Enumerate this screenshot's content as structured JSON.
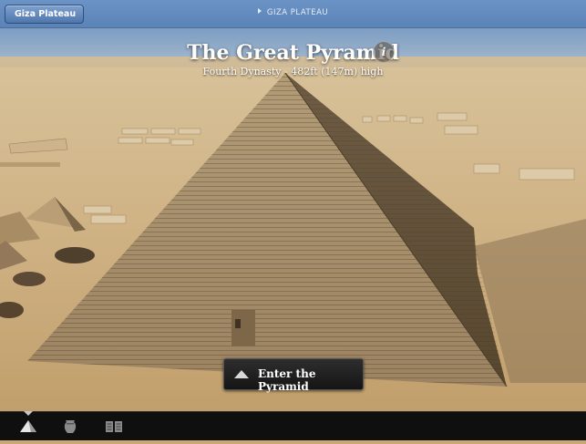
{
  "nav": {
    "back_label": "Giza Plateau",
    "breadcrumb": "GIZA PLATEAU"
  },
  "hero": {
    "title": "The Great Pyramid",
    "subtitle": "Fourth Dynasty - 482ft (147m) high",
    "info_icon": "info-icon"
  },
  "action": {
    "enter_label": "Enter the Pyramid",
    "icon": "pyramid-icon"
  },
  "tabs": [
    {
      "icon": "pyramid-icon",
      "active": true
    },
    {
      "icon": "vase-icon",
      "active": false
    },
    {
      "icon": "book-icon",
      "active": false
    }
  ]
}
